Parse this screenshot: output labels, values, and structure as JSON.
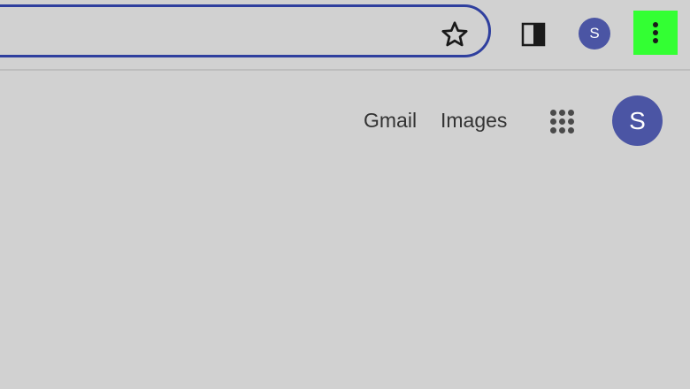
{
  "browser": {
    "omnibox": {
      "value": "",
      "placeholder": ""
    },
    "profile_initial": "S",
    "icons": {
      "bookmark": "star-icon",
      "side_panel": "side-panel-icon",
      "menu": "three-dot-menu-icon"
    },
    "colors": {
      "omnibox_border": "#2f3f9e",
      "profile_bg": "#4b55a4",
      "menu_highlight": "#33ff33",
      "background": "#d1d1d1"
    }
  },
  "google_header": {
    "gmail_label": "Gmail",
    "images_label": "Images",
    "apps_icon": "apps-grid-icon",
    "account_initial": "S"
  }
}
